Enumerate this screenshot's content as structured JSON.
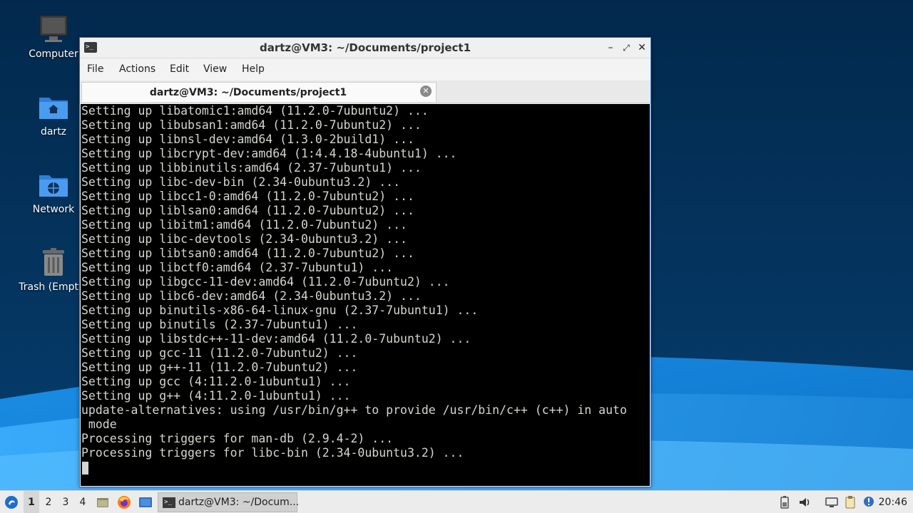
{
  "desktop": {
    "icons": [
      {
        "label": "Computer",
        "icon": "computer-icon"
      },
      {
        "label": "dartz",
        "icon": "home-folder-icon"
      },
      {
        "label": "Network",
        "icon": "network-folder-icon"
      },
      {
        "label": "Trash (Empty)",
        "icon": "trash-icon"
      }
    ]
  },
  "window": {
    "title": "dartz@VM3: ~/Documents/project1",
    "menu": [
      "File",
      "Actions",
      "Edit",
      "View",
      "Help"
    ],
    "tab": {
      "title": "dartz@VM3: ~/Documents/project1"
    },
    "terminal_lines": [
      "Setting up libatomic1:amd64 (11.2.0-7ubuntu2) ...",
      "Setting up libubsan1:amd64 (11.2.0-7ubuntu2) ...",
      "Setting up libnsl-dev:amd64 (1.3.0-2build1) ...",
      "Setting up libcrypt-dev:amd64 (1:4.4.18-4ubuntu1) ...",
      "Setting up libbinutils:amd64 (2.37-7ubuntu1) ...",
      "Setting up libc-dev-bin (2.34-0ubuntu3.2) ...",
      "Setting up libcc1-0:amd64 (11.2.0-7ubuntu2) ...",
      "Setting up liblsan0:amd64 (11.2.0-7ubuntu2) ...",
      "Setting up libitm1:amd64 (11.2.0-7ubuntu2) ...",
      "Setting up libc-devtools (2.34-0ubuntu3.2) ...",
      "Setting up libtsan0:amd64 (11.2.0-7ubuntu2) ...",
      "Setting up libctf0:amd64 (2.37-7ubuntu1) ...",
      "Setting up libgcc-11-dev:amd64 (11.2.0-7ubuntu2) ...",
      "Setting up libc6-dev:amd64 (2.34-0ubuntu3.2) ...",
      "Setting up binutils-x86-64-linux-gnu (2.37-7ubuntu1) ...",
      "Setting up binutils (2.37-7ubuntu1) ...",
      "Setting up libstdc++-11-dev:amd64 (11.2.0-7ubuntu2) ...",
      "Setting up gcc-11 (11.2.0-7ubuntu2) ...",
      "Setting up g++-11 (11.2.0-7ubuntu2) ...",
      "Setting up gcc (4:11.2.0-1ubuntu1) ...",
      "Setting up g++ (4:11.2.0-1ubuntu1) ...",
      "update-alternatives: using /usr/bin/g++ to provide /usr/bin/c++ (c++) in auto",
      " mode",
      "Processing triggers for man-db (2.9.4-2) ...",
      "Processing triggers for libc-bin (2.34-0ubuntu3.2) ..."
    ]
  },
  "taskbar": {
    "workspaces": [
      "1",
      "2",
      "3",
      "4"
    ],
    "active_workspace": "1",
    "launchers": [
      "file-manager-icon",
      "firefox-icon",
      "desktop-icon"
    ],
    "task": {
      "label": "dartz@VM3: ~/Docum..."
    },
    "tray": [
      "battery-icon",
      "volume-icon",
      "network-icon",
      "clipboard-icon",
      "notification-icon"
    ],
    "clock": "20:46"
  },
  "colors": {
    "wallpaper_dark": "#04325c",
    "wallpaper_light": "#1e8fe0",
    "terminal_bg": "#000000",
    "terminal_fg": "#d3d7cf",
    "window_border": "#2b6fd6"
  }
}
